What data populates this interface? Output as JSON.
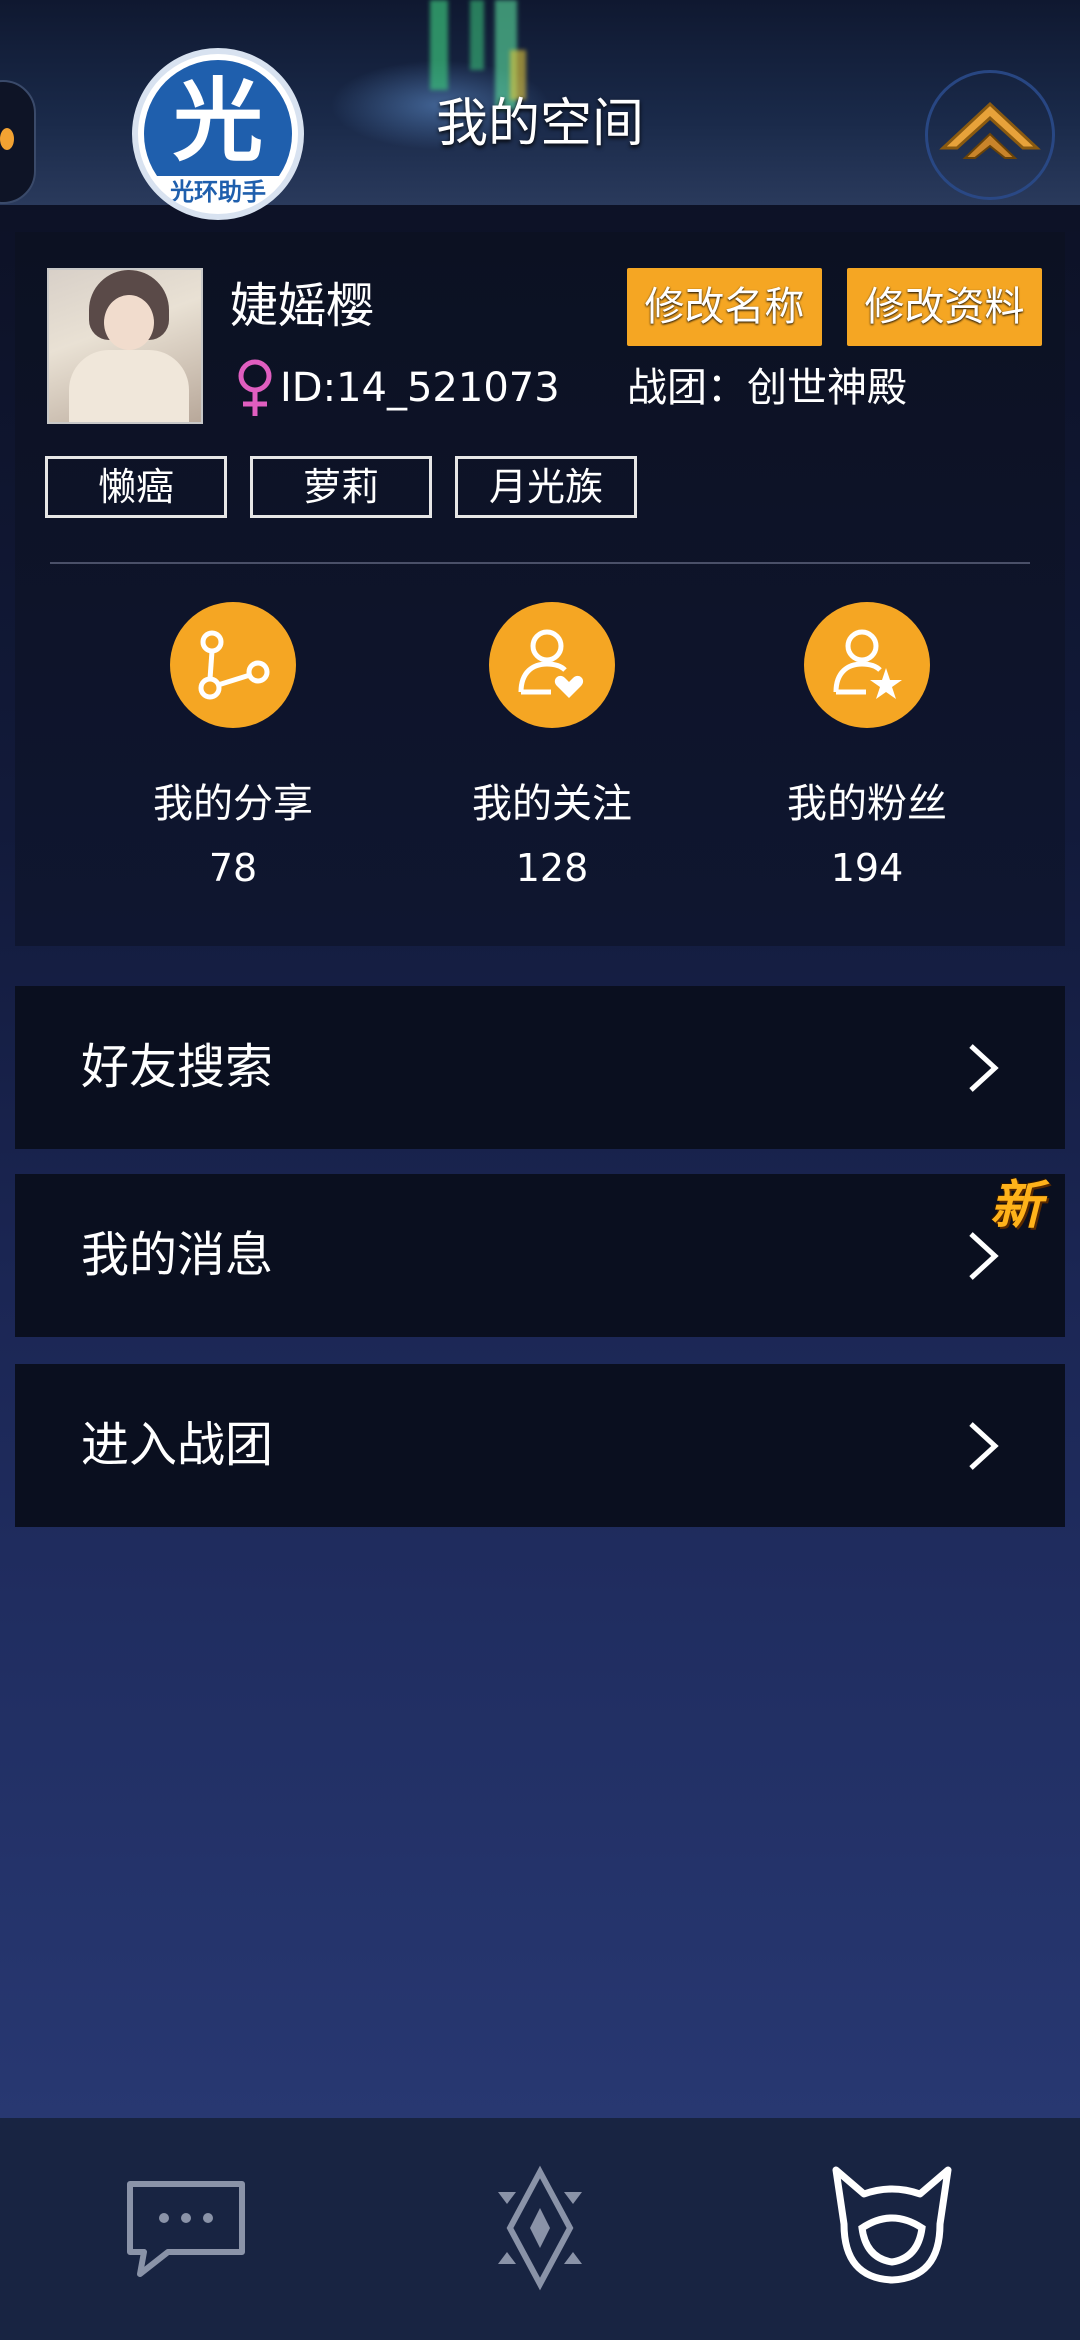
{
  "header": {
    "title": "我的空间",
    "logo_char": "光",
    "logo_caption": "光环助手"
  },
  "profile": {
    "username": "婕媱樱",
    "gender": "female",
    "user_id": "ID:14_521073",
    "guild": "战团：创世神殿",
    "buttons": {
      "rename": "修改名称",
      "edit_profile": "修改资料"
    },
    "tags": [
      "懒癌",
      "萝莉",
      "月光族"
    ]
  },
  "stats": [
    {
      "label": "我的分享",
      "value": "78",
      "icon": "share-icon"
    },
    {
      "label": "我的关注",
      "value": "128",
      "icon": "follow-heart-icon"
    },
    {
      "label": "我的粉丝",
      "value": "194",
      "icon": "fans-star-icon"
    }
  ],
  "menu": [
    {
      "label": "好友搜索"
    },
    {
      "label": "我的消息",
      "badge": "新"
    },
    {
      "label": "进入战团"
    }
  ],
  "bottom_nav": [
    {
      "icon": "chat-bubble-icon"
    },
    {
      "icon": "diamond-emblem-icon"
    },
    {
      "icon": "cat-face-icon",
      "active": true
    }
  ],
  "colors": {
    "accent": "#f5a623",
    "background": "#1b2654",
    "gender_female": "#e05ec0"
  }
}
